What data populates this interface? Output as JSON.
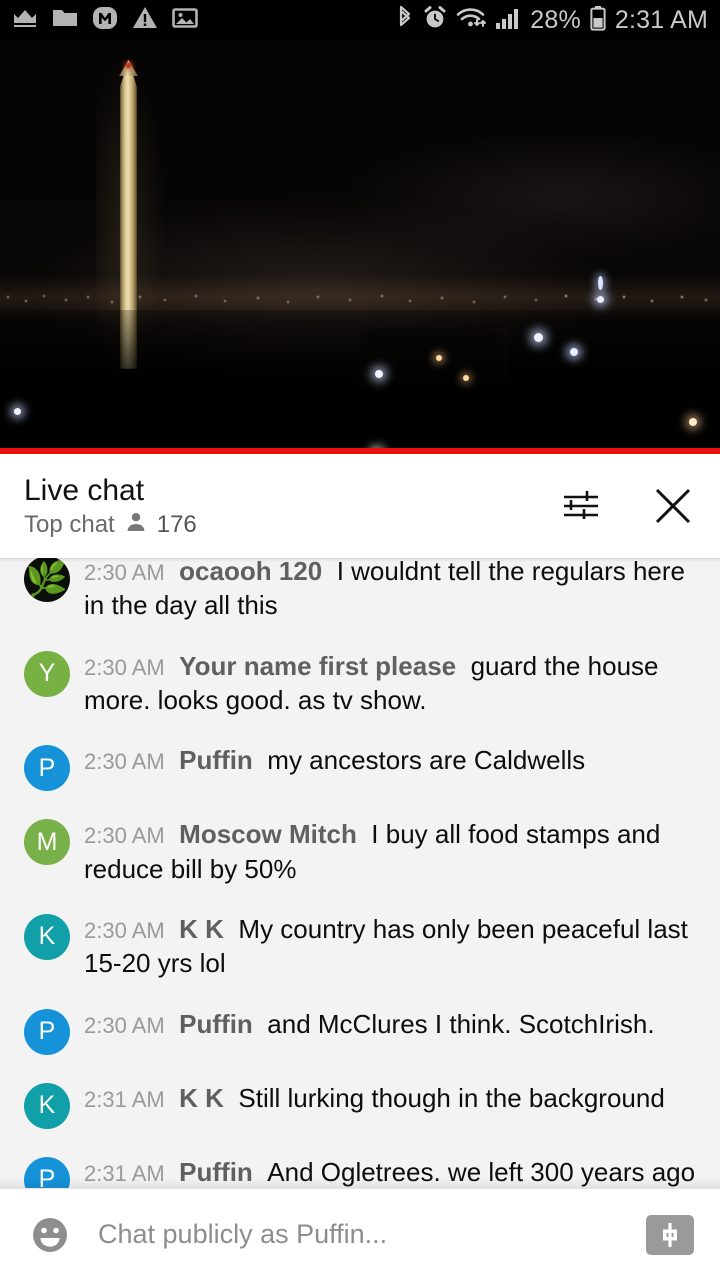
{
  "status_bar": {
    "left_icons": [
      "crown-icon",
      "folder-icon",
      "m-app-icon",
      "warning-icon",
      "image-icon"
    ],
    "right_icons": [
      "bluetooth-icon",
      "alarm-icon",
      "wifi-icon",
      "signal-icon",
      "battery-icon"
    ],
    "battery_percent": "28%",
    "time": "2:31 AM"
  },
  "video": {
    "name": "washington-monument-night-livestream",
    "progress_percent": 100,
    "progress_color": "#e8110f"
  },
  "chat_header": {
    "title": "Live chat",
    "subtitle": "Top chat",
    "viewer_count": "176",
    "person_icon": "person-icon",
    "settings_icon": "tune-sliders-icon",
    "close_icon": "close-icon"
  },
  "messages": [
    {
      "avatar_letter": "",
      "avatar_icon": "cannabis-leaf-avatar",
      "avatar_color": "#0b0f0a",
      "time": "2:30 AM",
      "author": "ocaooh 120",
      "text": "I wouldnt tell the regulars here in the day all this",
      "clipped": true
    },
    {
      "avatar_letter": "Y",
      "avatar_icon": "letter-avatar",
      "avatar_color": "#77b043",
      "time": "2:30 AM",
      "author": "Your name first please",
      "text": "guard the house more. looks good. as tv show.",
      "clipped": false
    },
    {
      "avatar_letter": "P",
      "avatar_icon": "letter-avatar",
      "avatar_color": "#1592d8",
      "time": "2:30 AM",
      "author": "Puffin",
      "text": "my ancestors are Caldwells",
      "clipped": false
    },
    {
      "avatar_letter": "M",
      "avatar_icon": "letter-avatar",
      "avatar_color": "#78b04a",
      "time": "2:30 AM",
      "author": "Moscow Mitch",
      "text": "I buy all food stamps and reduce bill by 50%",
      "clipped": false
    },
    {
      "avatar_letter": "K",
      "avatar_icon": "letter-avatar",
      "avatar_color": "#11a0a8",
      "time": "2:30 AM",
      "author": "K K",
      "text": "My country has only been peaceful last 15-20 yrs lol",
      "clipped": false
    },
    {
      "avatar_letter": "P",
      "avatar_icon": "letter-avatar",
      "avatar_color": "#1592d8",
      "time": "2:30 AM",
      "author": "Puffin",
      "text": "and McClures I think. ScotchIrish.",
      "clipped": false
    },
    {
      "avatar_letter": "K",
      "avatar_icon": "letter-avatar",
      "avatar_color": "#11a0a8",
      "time": "2:31 AM",
      "author": "K K",
      "text": "Still lurking though in the background",
      "clipped": false
    },
    {
      "avatar_letter": "P",
      "avatar_icon": "letter-avatar",
      "avatar_color": "#1592d8",
      "time": "2:31 AM",
      "author": "Puffin",
      "text": "And Ogletrees. we left 300 years ago",
      "clipped": false
    }
  ],
  "input_bar": {
    "emoji_icon": "emoji-smiley-icon",
    "placeholder": "Chat publicly as Puffin...",
    "value": "",
    "superchat_icon": "dollar-superchat-icon"
  }
}
